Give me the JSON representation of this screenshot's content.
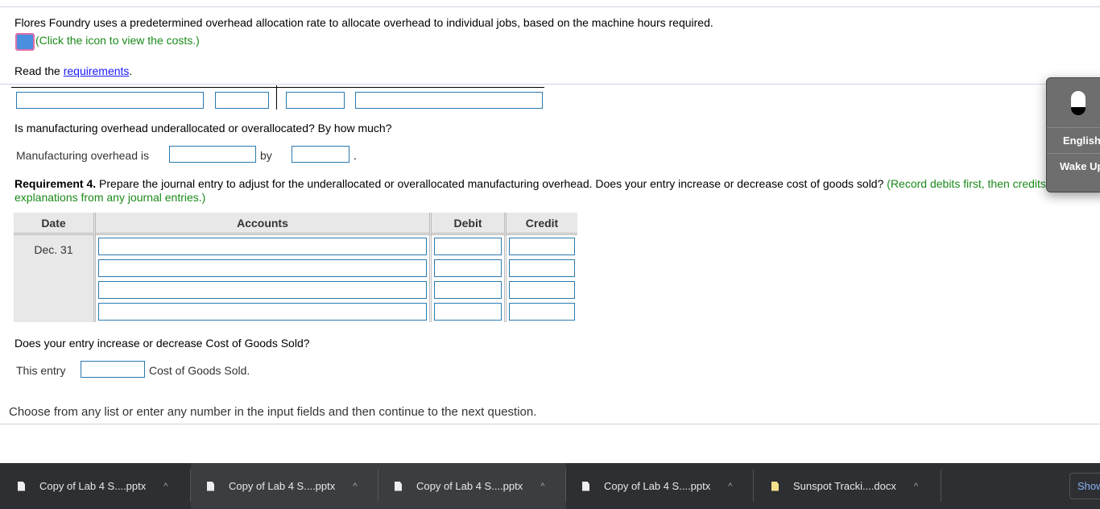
{
  "intro": {
    "text": "Flores Foundry uses a predetermined overhead allocation rate to allocate overhead to individual jobs, based on the machine hours required.",
    "icon_note": "(Click the icon to view the costs.)",
    "read_prefix": "Read the ",
    "read_link": "requirements",
    "read_suffix": "."
  },
  "question": "Is manufacturing overhead underallocated or overallocated? By how much?",
  "mfg_row": {
    "label": "Manufacturing overhead is",
    "by": "by",
    "period": "."
  },
  "req4": {
    "bold": "Requirement 4.",
    "text": " Prepare the journal entry to adjust for the underallocated or overallocated manufacturing overhead. Does your entry increase or decrease cost of goods sold?",
    "note": " (Record debits first, then credits. Exclude explanations from any journal entries.)"
  },
  "journal": {
    "headers": [
      "Date",
      "Accounts",
      "Debit",
      "Credit"
    ],
    "date": "Dec. 31",
    "rows": 4
  },
  "cogs_q": "Does your entry increase or decrease Cost of Goods Sold?",
  "cogs_row": {
    "label": "This entry",
    "suffix": "Cost of Goods Sold."
  },
  "footer": "Choose from any list or enter any number in the input fields and then continue to the next question.",
  "voice": {
    "language": "English",
    "wake": "Wake Up"
  },
  "downloads": [
    {
      "name": "Copy of Lab 4 S....pptx"
    },
    {
      "name": "Copy of Lab 4 S....pptx"
    },
    {
      "name": "Copy of Lab 4 S....pptx"
    },
    {
      "name": "Copy of Lab 4 S....pptx"
    },
    {
      "name": "Sunspot Tracki....docx"
    }
  ],
  "show_all": "Show all"
}
